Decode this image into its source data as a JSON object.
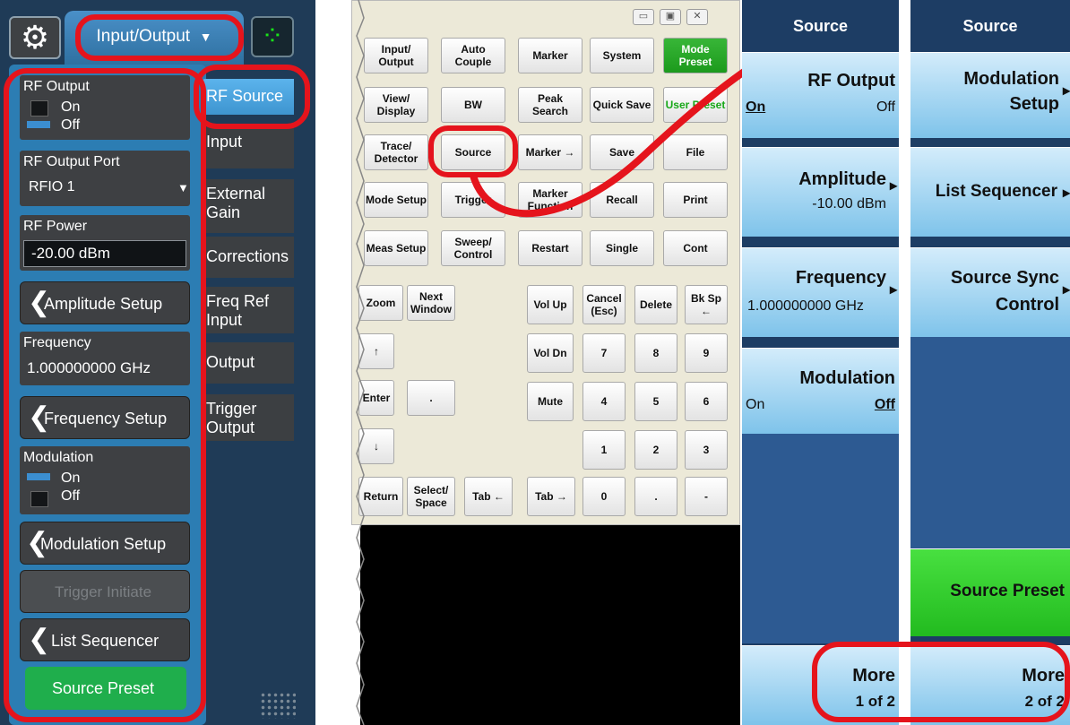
{
  "left_panel": {
    "top_tab_label": "Input/Output",
    "dropdown_arrow": "▼",
    "gear_icon": "⚙",
    "spinner_icon": "⁘",
    "rf_output": {
      "title": "RF Output",
      "on": "On",
      "off": "Off"
    },
    "rf_output_port": {
      "title": "RF Output Port",
      "value": "RFIO 1",
      "arrow": "▼"
    },
    "rf_power": {
      "title": "RF Power",
      "value": "-20.00 dBm"
    },
    "amplitude_setup": "Amplitude Setup",
    "frequency": {
      "title": "Frequency",
      "value": "1.000000000 GHz"
    },
    "frequency_setup": "Frequency Setup",
    "modulation": {
      "title": "Modulation",
      "on": "On",
      "off": "Off"
    },
    "modulation_setup": "Modulation Setup",
    "trigger_initiate": "Trigger Initiate",
    "list_sequencer": "List Sequencer",
    "source_preset": "Source Preset",
    "chevron": "❮",
    "side_tabs": [
      "RF Source",
      "Input",
      "External Gain",
      "Corrections",
      "Freq Ref Input",
      "Output",
      "Trigger Output"
    ]
  },
  "keyboard": {
    "window_controls": [
      "▭",
      "▣",
      "✕"
    ],
    "rows": [
      [
        "Input/ Output",
        "Auto Couple",
        "Marker",
        "System",
        "Mode Preset"
      ],
      [
        "View/ Display",
        "BW",
        "Peak Search",
        "Quick Save",
        "User Preset"
      ],
      [
        "Trace/ Detector",
        "Source",
        "Marker →",
        "Save",
        "File"
      ],
      [
        "Mode Setup",
        "Trigger",
        "Marker Function",
        "Recall",
        "Print"
      ],
      [
        "Meas Setup",
        "Sweep/ Control",
        "Restart",
        "Single",
        "Cont"
      ]
    ],
    "nav": [
      "Zoom",
      "Next Window",
      "↑",
      "Enter",
      ".",
      "↓",
      "Return",
      "Select/ Space",
      "Tab ←",
      "Tab →"
    ],
    "pad": [
      [
        "Vol Up",
        "Cancel (Esc)",
        "Delete",
        "Bk Sp ←"
      ],
      [
        "Vol Dn",
        "7",
        "8",
        "9"
      ],
      [
        "Mute",
        "4",
        "5",
        "6"
      ],
      [
        "1",
        "2",
        "3"
      ],
      [
        "0",
        ".",
        "-"
      ]
    ]
  },
  "softkeys1": {
    "header": "Source",
    "rf_output": {
      "title": "RF Output",
      "on": "On",
      "off": "Off"
    },
    "amplitude": {
      "title": "Amplitude",
      "value": "-10.00 dBm"
    },
    "frequency": {
      "title": "Frequency",
      "value": "1.000000000 GHz"
    },
    "modulation": {
      "title": "Modulation",
      "on": "On",
      "off": "Off"
    },
    "more": {
      "title": "More",
      "page": "1 of 2"
    },
    "arrow": "▸"
  },
  "softkeys2": {
    "header": "Source",
    "modulation_setup": {
      "line1": "Modulation",
      "line2": "Setup"
    },
    "list_sequencer": "List Sequencer",
    "source_sync": {
      "line1": "Source Sync",
      "line2": "Control"
    },
    "source_preset": "Source Preset",
    "more": {
      "title": "More",
      "page": "2 of 2"
    },
    "arrow": "▸"
  },
  "colors": {
    "highlight_ring": "#e5141c",
    "accent_blue": "#2c7db3",
    "green_button": "#1fae4c",
    "mode_preset_green": "#1c9a1c"
  }
}
